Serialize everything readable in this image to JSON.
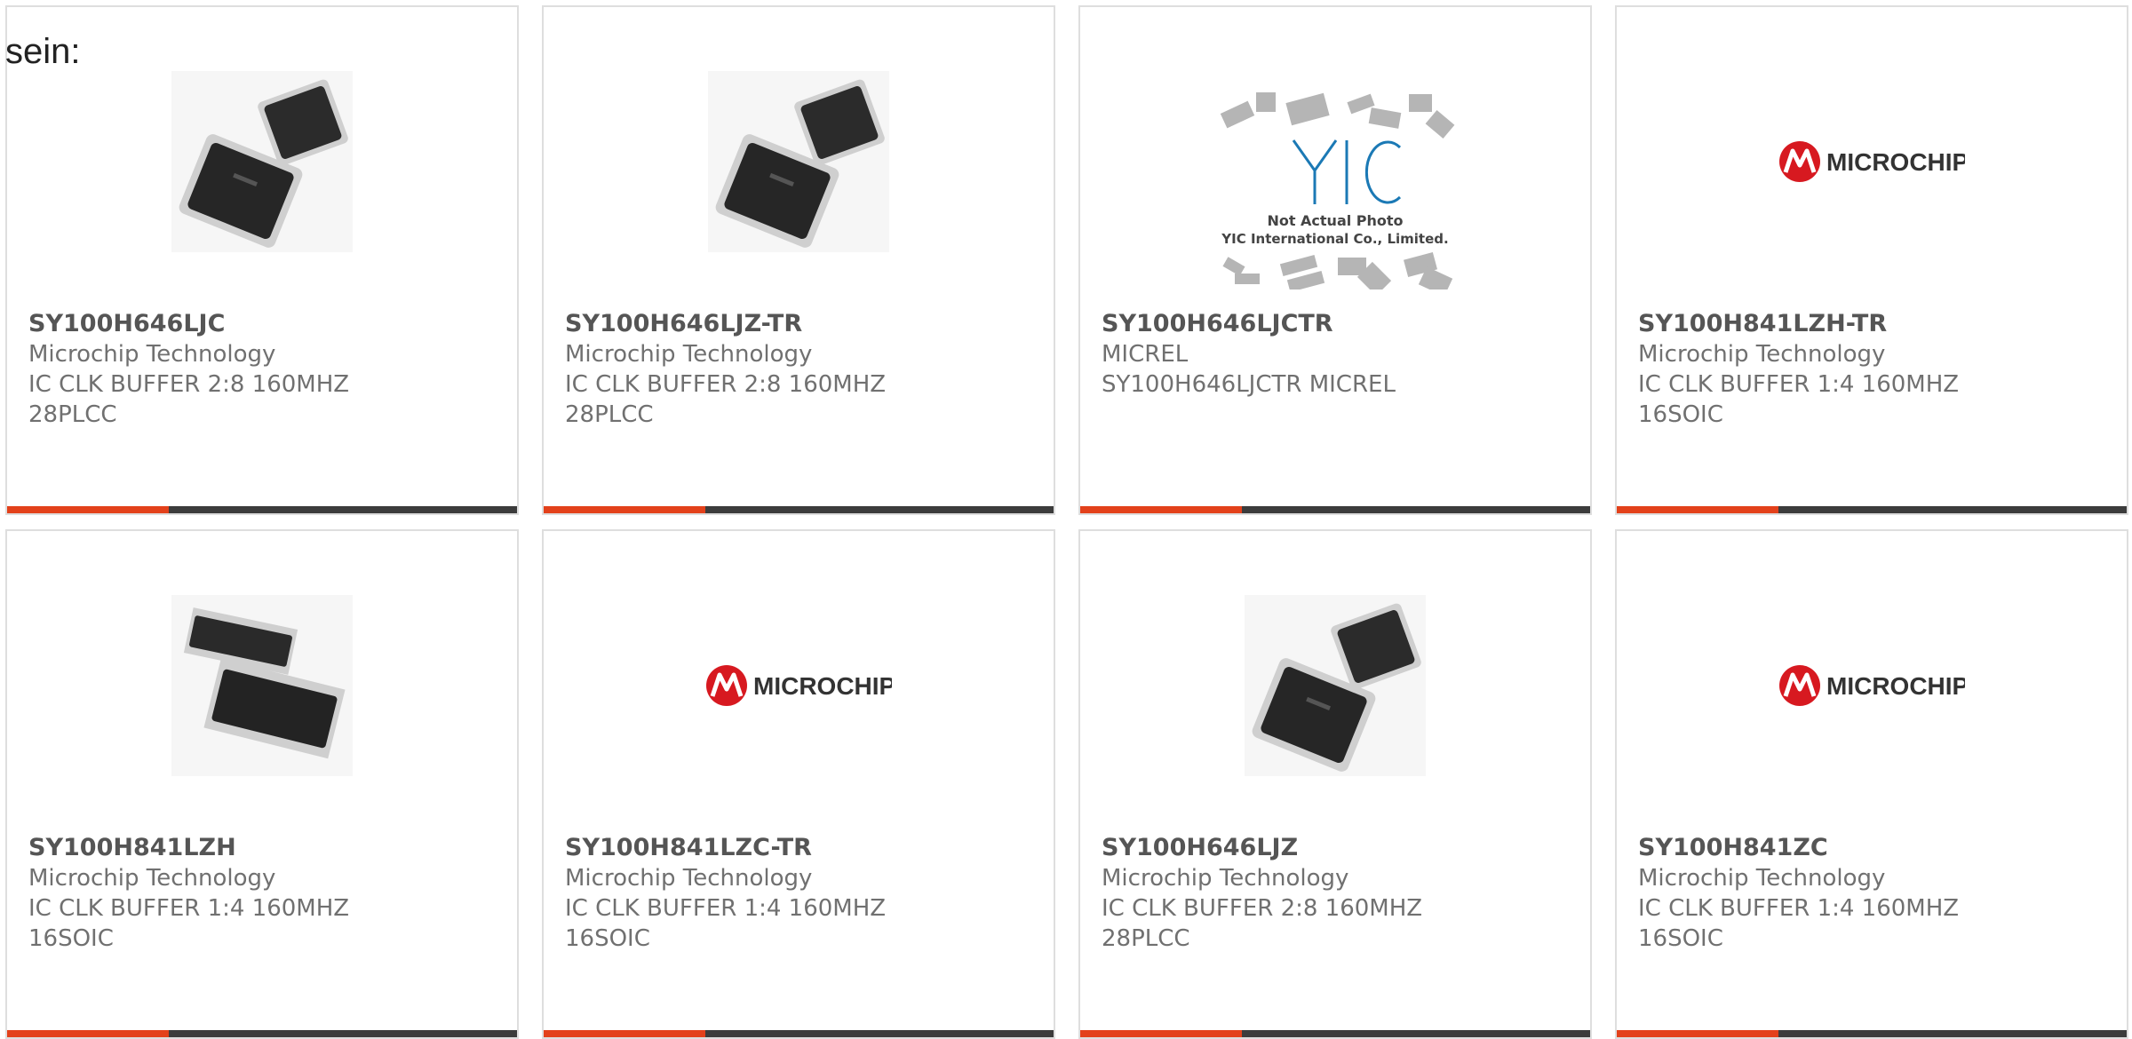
{
  "intro": "sein:",
  "colors": {
    "accent": "#e3411b",
    "bar": "#3c3c3c"
  },
  "products": [
    {
      "part": "SY100H646LJC",
      "maker": "Microchip Technology",
      "desc": "IC CLK BUFFER 2:8 160MHZ\n28PLCC",
      "image": "plcc-chip-photo"
    },
    {
      "part": "SY100H646LJZ-TR",
      "maker": "Microchip Technology",
      "desc": "IC CLK BUFFER 2:8 160MHZ\n28PLCC",
      "image": "plcc-chip-photo"
    },
    {
      "part": "SY100H646LJCTR",
      "maker": "MICREL",
      "desc": "SY100H646LJCTR MICREL",
      "image": "yic-placeholder",
      "image_text": [
        "YIC",
        "Not Actual Photo",
        "YIC International Co., Limited."
      ]
    },
    {
      "part": "SY100H841LZH-TR",
      "maker": "Microchip Technology",
      "desc": "IC CLK BUFFER 1:4 160MHZ\n16SOIC",
      "image": "microchip-logo",
      "image_text": [
        "MICROCHIP"
      ]
    },
    {
      "part": "SY100H841LZH",
      "maker": "Microchip Technology",
      "desc": "IC CLK BUFFER 1:4 160MHZ\n16SOIC",
      "image": "soic-chip-photo"
    },
    {
      "part": "SY100H841LZC-TR",
      "maker": "Microchip Technology",
      "desc": "IC CLK BUFFER 1:4 160MHZ\n16SOIC",
      "image": "microchip-logo",
      "image_text": [
        "MICROCHIP"
      ]
    },
    {
      "part": "SY100H646LJZ",
      "maker": "Microchip Technology",
      "desc": "IC CLK BUFFER 2:8 160MHZ\n28PLCC",
      "image": "plcc-chip-photo"
    },
    {
      "part": "SY100H841ZC",
      "maker": "Microchip Technology",
      "desc": "IC CLK BUFFER 1:4 160MHZ\n16SOIC",
      "image": "microchip-logo",
      "image_text": [
        "MICROCHIP"
      ]
    }
  ]
}
